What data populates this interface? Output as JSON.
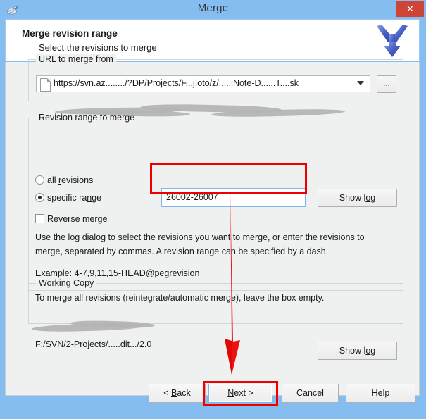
{
  "window": {
    "title": "Merge",
    "app_icon": "tortoisesvn-icon",
    "close_label": "✕"
  },
  "header": {
    "title": "Merge revision range",
    "subtitle": "Select the revisions to merge",
    "logo_icon": "merge-arrow-icon"
  },
  "url_group": {
    "legend": "URL to merge from",
    "combo_value": "https://svn.az......../?DP/Projects/F...j!oto/z/.....iNote-D......T....sk",
    "combo_icon": "document-icon",
    "dropdown_icon": "chevron-down-icon",
    "browse_label": "...",
    "redacted": true
  },
  "revision_group": {
    "legend": "Revision range to merge",
    "all_revisions_label_pre": "all ",
    "all_revisions_accel": "r",
    "all_revisions_label_post": "evisions",
    "all_revisions_checked": false,
    "specific_range_label_pre": "specific ra",
    "specific_range_accel": "n",
    "specific_range_label_post": "ge",
    "specific_range_checked": true,
    "reverse_merge_label_pre": "R",
    "reverse_merge_accel": "e",
    "reverse_merge_label_post": "verse merge",
    "reverse_merge_checked": false,
    "revision_value": "26002-26007",
    "show_log_label_pre": "Show l",
    "show_log_accel": "o",
    "show_log_label_post": "g",
    "help_paragraph_1": "Use the log dialog to select the revisions you want to merge, or enter the revisions to merge, separated by commas. A revision range can be specified by a dash.",
    "help_paragraph_2": "Example: 4-7,9,11,15-HEAD@pegrevision",
    "help_paragraph_3": "To merge all revisions (reintegrate/automatic merge), leave the box empty."
  },
  "working_copy_group": {
    "legend": "Working Copy",
    "path_value": "F:/SVN/2-Projects/.....dit.../2.0",
    "show_log_label_pre": "Show l",
    "show_log_accel": "o",
    "show_log_label_post": "g",
    "redacted": true
  },
  "buttons": {
    "back_pre": "< ",
    "back_accel": "B",
    "back_post": "ack",
    "next_pre": "",
    "next_accel": "N",
    "next_post": "ext >",
    "cancel": "Cancel",
    "help": "Help"
  },
  "annotations": {
    "highlight_color": "#ee0000",
    "arrow_icon": "red-down-arrow-annotation",
    "highlight_revision_box": true,
    "highlight_next_button": true
  },
  "colors": {
    "titlebar": "#85bdf0",
    "close_button": "#d04437",
    "panel": "#eff0f0",
    "focus_border": "#7eb4ea",
    "annotation": "#ee0000"
  }
}
